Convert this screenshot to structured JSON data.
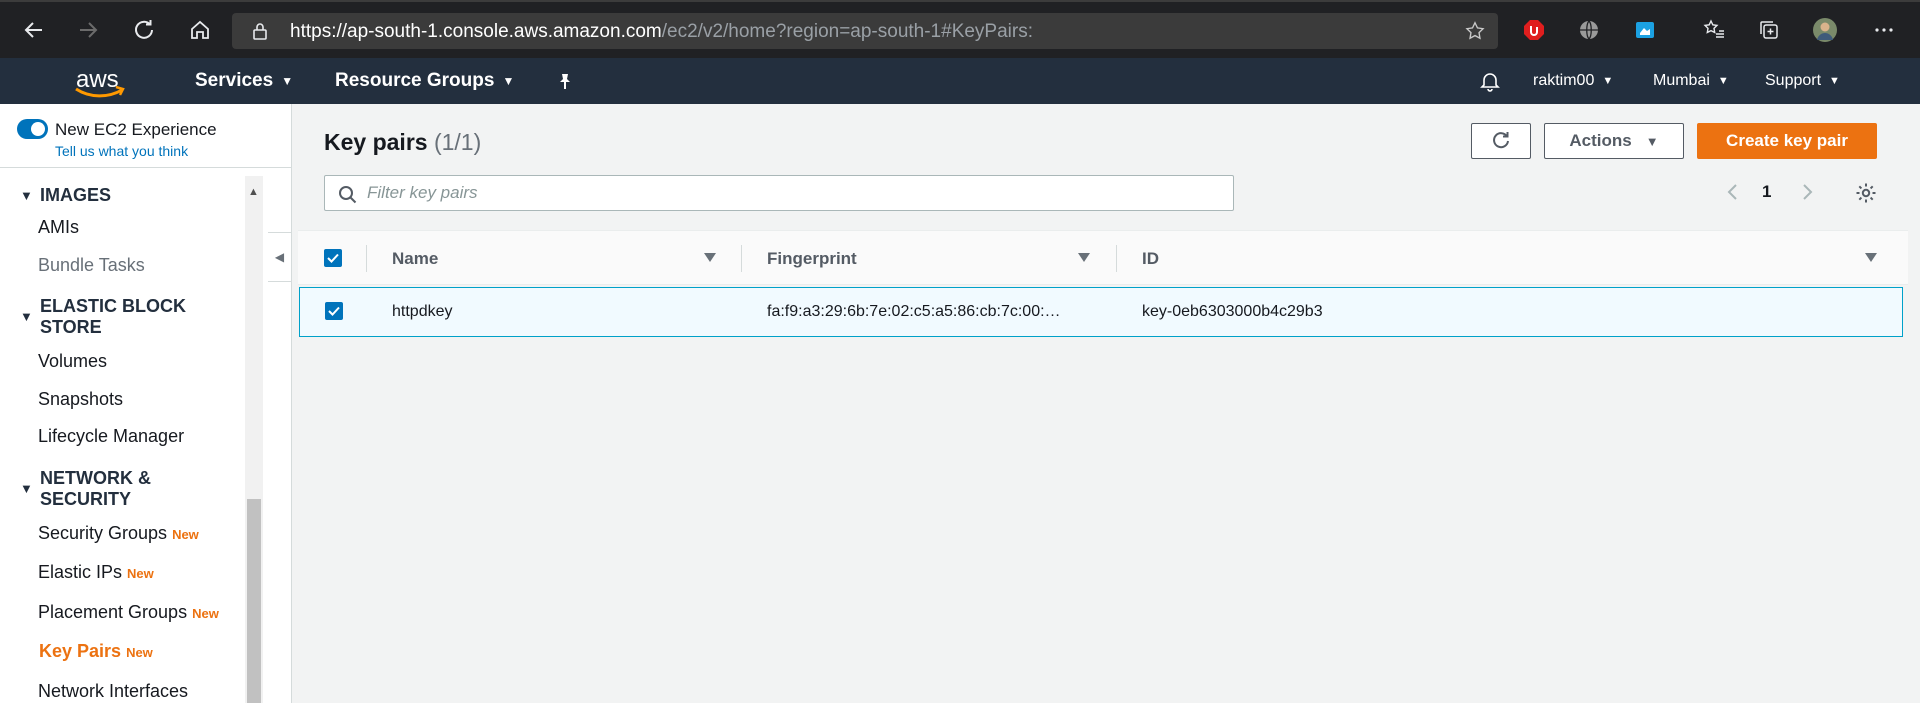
{
  "browser": {
    "url_host": "https://ap-south-1.console.aws.amazon.com",
    "url_rest": "/ec2/v2/home?region=ap-south-1#KeyPairs:"
  },
  "aws_nav": {
    "logo_text": "aws",
    "services_label": "Services",
    "resource_groups_label": "Resource Groups",
    "user_label": "raktim00",
    "region_label": "Mumbai",
    "support_label": "Support"
  },
  "sidebar": {
    "toggle_label": "New EC2 Experience",
    "feedback_link": "Tell us what you think",
    "sections": [
      {
        "title": "IMAGES",
        "items": [
          {
            "label": "AMIs"
          },
          {
            "label": "Bundle Tasks"
          }
        ]
      },
      {
        "title": "ELASTIC BLOCK STORE",
        "items": [
          {
            "label": "Volumes"
          },
          {
            "label": "Snapshots"
          },
          {
            "label": "Lifecycle Manager"
          }
        ]
      },
      {
        "title": "NETWORK & SECURITY",
        "items": [
          {
            "label": "Security Groups",
            "badge": "New"
          },
          {
            "label": "Elastic IPs",
            "badge": "New"
          },
          {
            "label": "Placement Groups",
            "badge": "New"
          },
          {
            "label": "Key Pairs",
            "badge": "New"
          },
          {
            "label": "Network Interfaces"
          }
        ]
      }
    ]
  },
  "main": {
    "title": "Key pairs",
    "count": "(1/1)",
    "actions_label": "Actions",
    "create_label": "Create key pair",
    "search_placeholder": "Filter key pairs",
    "page_number": "1",
    "columns": [
      "Name",
      "Fingerprint",
      "ID"
    ],
    "rows": [
      {
        "name": "httpdkey",
        "fingerprint": "fa:f9:a3:29:6b:7e:02:c5:a5:86:cb:7c:00:…",
        "id": "key-0eb6303000b4c29b3"
      }
    ]
  },
  "colors": {
    "accent_orange": "#ec7211",
    "link_blue": "#0073bb",
    "nav_bg": "#232f3e"
  }
}
